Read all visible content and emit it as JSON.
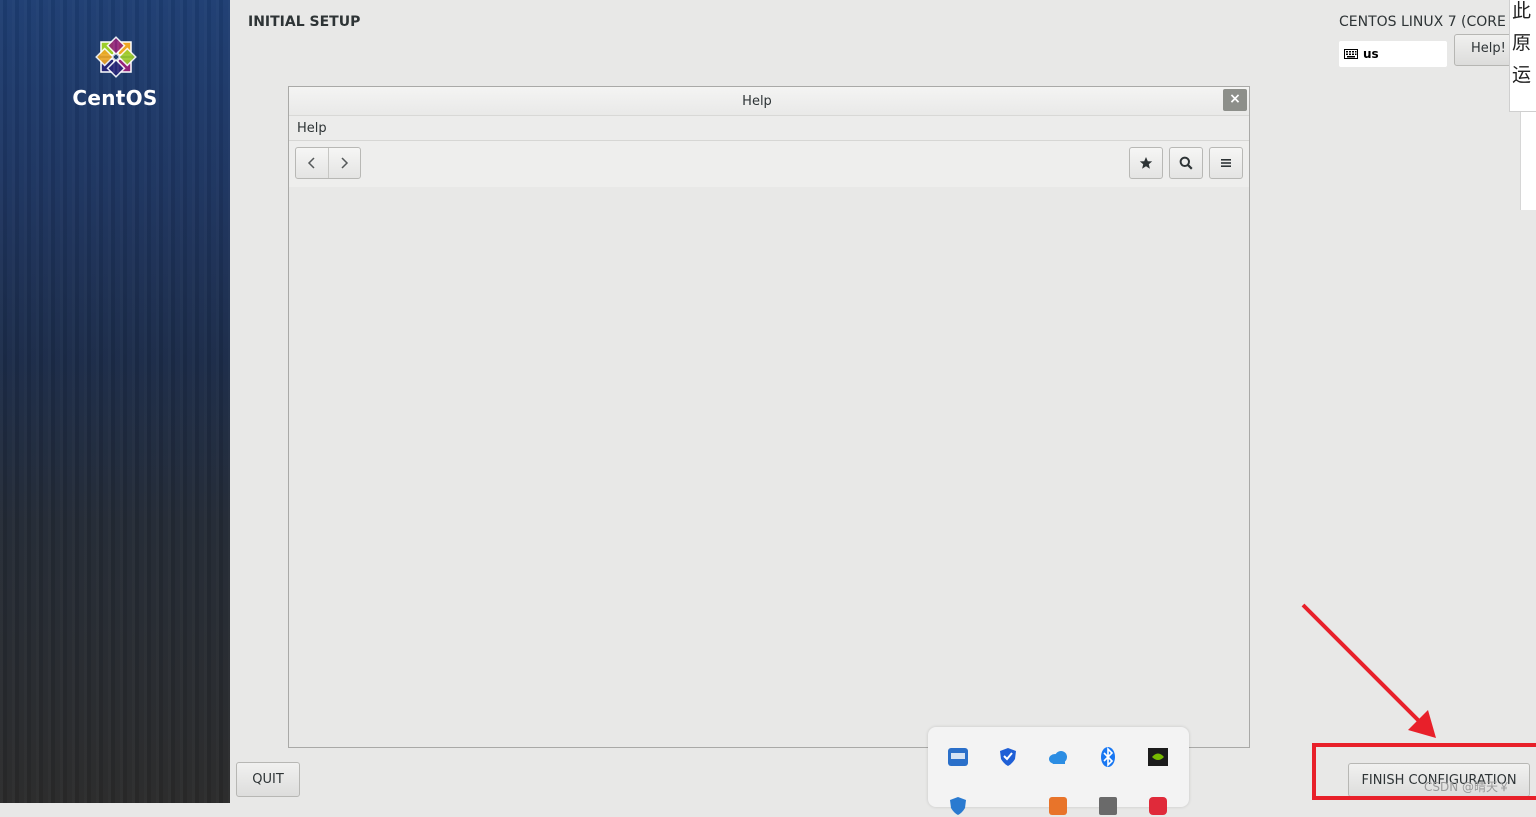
{
  "sidebar": {
    "brand": "CentOS"
  },
  "header": {
    "page_title": "INITIAL SETUP",
    "product_name": "CENTOS LINUX 7 (CORE",
    "keyboard_layout": "us",
    "help_button_label": "Help!"
  },
  "side_note": {
    "lines": [
      "此",
      "原",
      "运"
    ]
  },
  "help_window": {
    "title": "Help",
    "close_label": "×",
    "menu_label": "Help",
    "toolbar": {
      "back_icon": "chevron-left-icon",
      "forward_icon": "chevron-right-icon",
      "bookmark_icon": "star-icon",
      "search_icon": "search-icon",
      "menu_icon": "hamburger-menu-icon"
    }
  },
  "footer": {
    "quit_label": "QUIT",
    "finish_label": "FINISH CONFIGURATION"
  },
  "tray": {
    "icons": [
      "app-icon",
      "shield-icon",
      "cloud-icon",
      "bluetooth-icon",
      "nvidia-icon"
    ]
  },
  "watermark": "CSDN @晴天￥",
  "colors": {
    "highlight": "#e8202a",
    "sidebar_top": "#1e3e73",
    "sidebar_bottom": "#2a2a2a",
    "background": "#e8e8e7"
  }
}
